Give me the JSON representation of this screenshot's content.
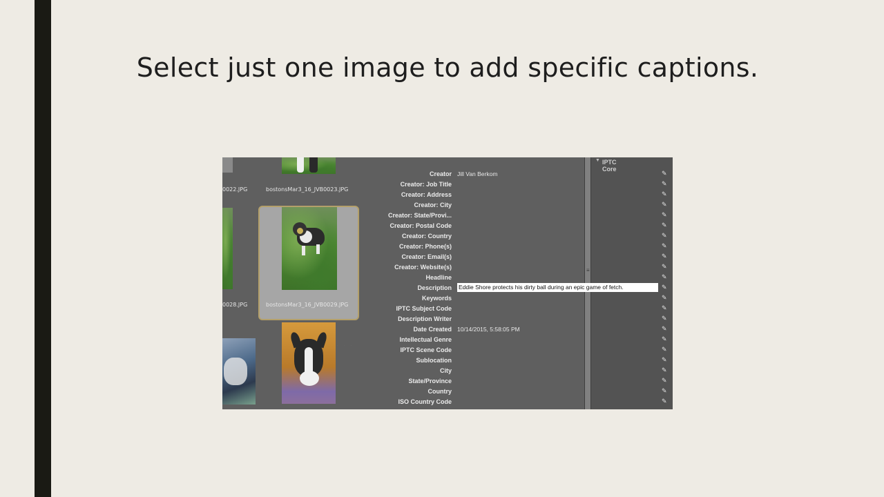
{
  "slide": {
    "title": "Select just one image to add specific captions."
  },
  "filmstrip": {
    "files": [
      {
        "name": "0022.JPG",
        "partial": true
      },
      {
        "name": "bostonsMar3_16_JVB0023.JPG"
      },
      {
        "name": "0028.JPG",
        "partial": true
      },
      {
        "name": "bostonsMar3_16_JVB0029.JPG",
        "selected": true
      }
    ],
    "rating_dots": ". . . . ."
  },
  "metadata": {
    "section": "IPTC Core",
    "fields": [
      {
        "label": "Creator",
        "value": "Jill Van Berkom"
      },
      {
        "label": "Creator: Job Title",
        "value": ""
      },
      {
        "label": "Creator: Address",
        "value": ""
      },
      {
        "label": "Creator: City",
        "value": ""
      },
      {
        "label": "Creator: State/Provi...",
        "value": ""
      },
      {
        "label": "Creator: Postal Code",
        "value": ""
      },
      {
        "label": "Creator: Country",
        "value": ""
      },
      {
        "label": "Creator: Phone(s)",
        "value": ""
      },
      {
        "label": "Creator: Email(s)",
        "value": ""
      },
      {
        "label": "Creator: Website(s)",
        "value": ""
      },
      {
        "label": "Headline",
        "value": ""
      },
      {
        "label": "Description",
        "value": "Eddie Shore protects his dirty ball during an epic game of fetch.",
        "editing": true
      },
      {
        "label": "Keywords",
        "value": ""
      },
      {
        "label": "IPTC Subject Code",
        "value": ""
      },
      {
        "label": "Description Writer",
        "value": ""
      },
      {
        "label": "Date Created",
        "value": "10/14/2015, 5:58:05 PM"
      },
      {
        "label": "Intellectual Genre",
        "value": ""
      },
      {
        "label": "IPTC Scene Code",
        "value": ""
      },
      {
        "label": "Sublocation",
        "value": ""
      },
      {
        "label": "City",
        "value": ""
      },
      {
        "label": "State/Province",
        "value": ""
      },
      {
        "label": "Country",
        "value": ""
      },
      {
        "label": "ISO Country Code",
        "value": ""
      }
    ],
    "edit_icon": "pencil-icon"
  },
  "colors": {
    "background": "#eeebe4",
    "accent_bar": "#1a1a14",
    "selection_border": "#b4a06a"
  }
}
